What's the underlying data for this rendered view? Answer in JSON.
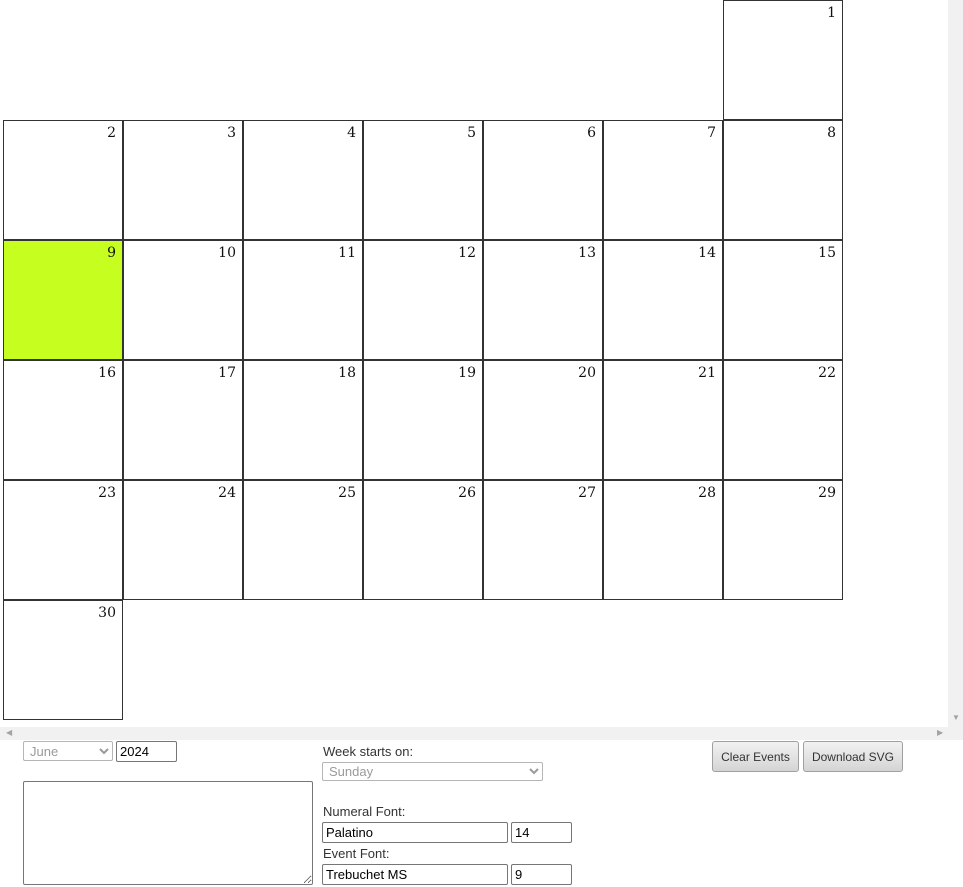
{
  "calendar": {
    "month_index": 5,
    "year_value": 2024,
    "first_weekday": 6,
    "days_in_month": 30,
    "highlighted_day": 9,
    "highlight_color": "#c6ff1f"
  },
  "controls": {
    "month_select": "June",
    "year_input": "2024",
    "week_start_label": "Week starts on:",
    "week_start_value": "Sunday",
    "numeral_font_label": "Numeral Font:",
    "numeral_font_value": "Palatino",
    "numeral_font_size": "14",
    "event_font_label": "Event Font:",
    "event_font_value": "Trebuchet MS",
    "event_font_size": "9",
    "events_text": "",
    "clear_button": "Clear Events",
    "download_button": "Download SVG"
  }
}
